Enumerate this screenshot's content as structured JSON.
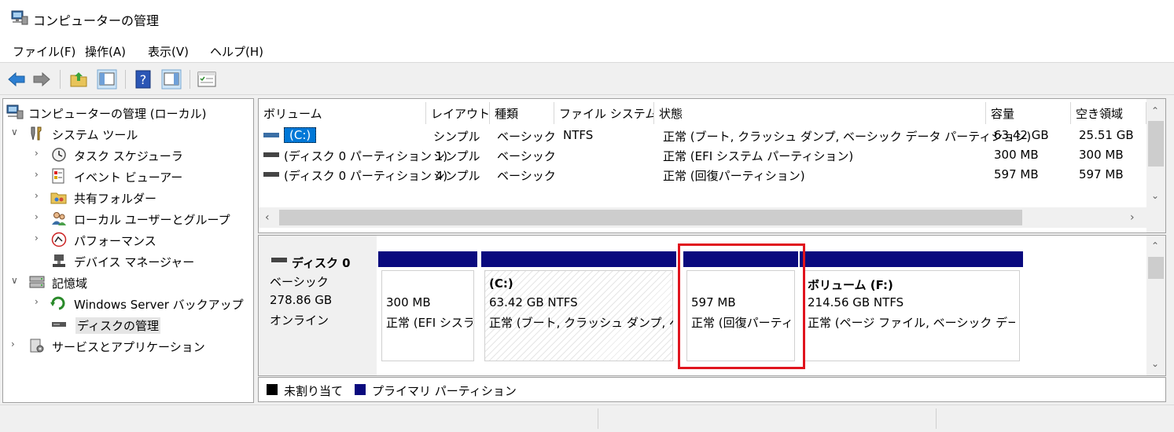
{
  "window": {
    "title": "コンピューターの管理",
    "icon": "computer-management-icon"
  },
  "menu": [
    {
      "label": "ファイル(F)"
    },
    {
      "label": "操作(A)"
    },
    {
      "label": "表示(V)"
    },
    {
      "label": "ヘルプ(H)"
    }
  ],
  "toolbar": {
    "buttons": [
      "back-arrow-icon",
      "forward-arrow-icon",
      "up-folder-icon",
      "show-hide-tree-icon",
      "help-icon",
      "action-pane-icon",
      "properties-icon"
    ]
  },
  "tree": {
    "root": "コンピューターの管理 (ローカル)",
    "items": [
      {
        "label": "システム ツール",
        "icon": "tools-icon",
        "chevron": "v"
      },
      {
        "label": "タスク スケジューラ",
        "icon": "clock-icon",
        "chevron": ">"
      },
      {
        "label": "イベント ビューアー",
        "icon": "event-viewer-icon",
        "chevron": ">"
      },
      {
        "label": "共有フォルダー",
        "icon": "shared-folder-icon",
        "chevron": ">"
      },
      {
        "label": "ローカル ユーザーとグループ",
        "icon": "users-icon",
        "chevron": ">"
      },
      {
        "label": "パフォーマンス",
        "icon": "performance-icon",
        "chevron": ">"
      },
      {
        "label": "デバイス マネージャー",
        "icon": "device-manager-icon",
        "chevron": ""
      },
      {
        "label": "記憶域",
        "icon": "storage-icon",
        "chevron": "v"
      },
      {
        "label": "Windows Server バックアップ",
        "icon": "backup-icon",
        "chevron": ">"
      },
      {
        "label": "ディスクの管理",
        "icon": "disk-management-icon",
        "chevron": ""
      },
      {
        "label": "サービスとアプリケーション",
        "icon": "services-icon",
        "chevron": ">"
      }
    ]
  },
  "volume_table": {
    "columns": [
      "ボリューム",
      "レイアウト",
      "種類",
      "ファイル システム",
      "状態",
      "容量",
      "空き領域"
    ],
    "rows": [
      {
        "volume": "(C:)",
        "layout": "シンプル",
        "type": "ベーシック",
        "fs": "NTFS",
        "status": "正常 (ブート, クラッシュ ダンプ, ベーシック データ パーティション)",
        "capacity": "63.42 GB",
        "free": "25.51 GB"
      },
      {
        "volume": "(ディスク 0 パーティション 1)",
        "layout": "シンプル",
        "type": "ベーシック",
        "fs": "",
        "status": "正常 (EFI システム パーティション)",
        "capacity": "300 MB",
        "free": "300 MB"
      },
      {
        "volume": "(ディスク 0 パーティション 4)",
        "layout": "シンプル",
        "type": "ベーシック",
        "fs": "",
        "status": "正常 (回復パーティション)",
        "capacity": "597 MB",
        "free": "597 MB"
      }
    ]
  },
  "disk": {
    "name": "ディスク 0",
    "kind": "ベーシック",
    "size": "278.86 GB",
    "state": "オンライン",
    "partitions": [
      {
        "title": "",
        "size": "300 MB",
        "status": "正常 (EFI シスラ"
      },
      {
        "title": "(C:)",
        "size": "63.42 GB NTFS",
        "status": "正常 (ブート, クラッシュ ダンプ, ベー"
      },
      {
        "title": "",
        "size": "597 MB",
        "status": "正常 (回復パーティ"
      },
      {
        "title": "ボリューム (F:)",
        "size": "214.56 GB NTFS",
        "status": "正常 (ページ ファイル, ベーシック データ /"
      }
    ]
  },
  "legend": [
    {
      "label": "未割り当て",
      "color": "#000000"
    },
    {
      "label": "プライマリ パーティション",
      "color": "#0a0a7e"
    }
  ],
  "highlight_color": "#e0141e"
}
